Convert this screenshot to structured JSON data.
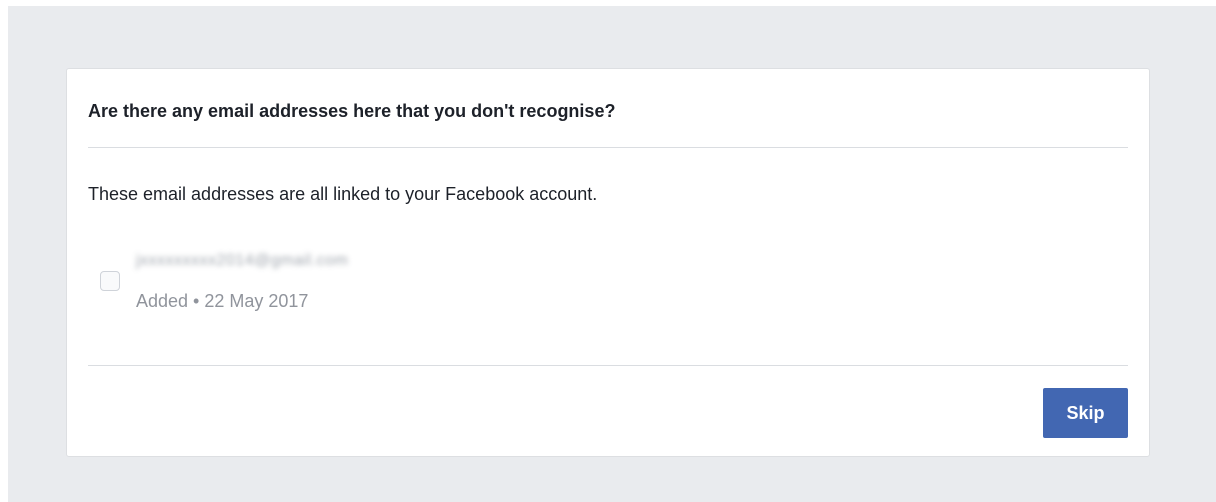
{
  "dialog": {
    "title": "Are there any email addresses here that you don't recognise?",
    "description": "These email addresses are all linked to your Facebook account.",
    "emails": [
      {
        "address": "jxxxxxxxxx2014@gmail.com",
        "meta": "Added • 22 May 2017",
        "checked": false
      }
    ],
    "skip_label": "Skip"
  },
  "colors": {
    "page_background": "#e9ebee",
    "primary_button": "#4267b2",
    "secondary_text": "#90949c"
  }
}
